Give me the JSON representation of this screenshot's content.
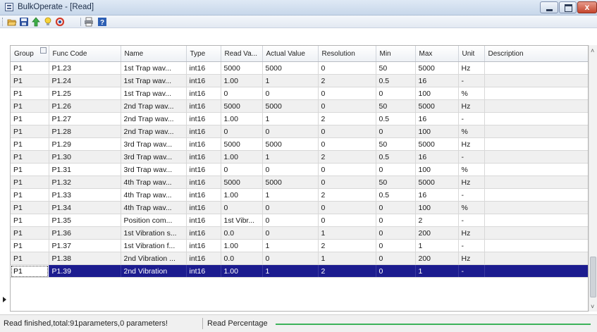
{
  "window": {
    "title": "BulkOperate - [Read]",
    "close_glyph": "x"
  },
  "toolbar": {
    "icons": [
      "open-folder-icon",
      "save-icon",
      "upload-arrow-icon",
      "lightbulb-icon",
      "refresh-icon",
      "print-icon",
      "help-icon"
    ]
  },
  "table": {
    "columns": [
      "Group",
      "Func Code",
      "Name",
      "Type",
      "Read Va...",
      "Actual Value",
      "Resolution",
      "Min",
      "Max",
      "Unit",
      "Description"
    ],
    "rows": [
      {
        "group": "P1",
        "code": "P1.23",
        "name": "1st Trap wav...",
        "type": "int16",
        "read": "5000",
        "actual": "5000",
        "resolution": "0",
        "min": "50",
        "max": "5000",
        "unit": "Hz",
        "desc": ""
      },
      {
        "group": "P1",
        "code": "P1.24",
        "name": "1st Trap wav...",
        "type": "int16",
        "read": "1.00",
        "actual": "1",
        "resolution": "2",
        "min": "0.5",
        "max": "16",
        "unit": "-",
        "desc": ""
      },
      {
        "group": "P1",
        "code": "P1.25",
        "name": "1st Trap wav...",
        "type": "int16",
        "read": "0",
        "actual": "0",
        "resolution": "0",
        "min": "0",
        "max": "100",
        "unit": "%",
        "desc": ""
      },
      {
        "group": "P1",
        "code": "P1.26",
        "name": "2nd Trap wav...",
        "type": "int16",
        "read": "5000",
        "actual": "5000",
        "resolution": "0",
        "min": "50",
        "max": "5000",
        "unit": "Hz",
        "desc": ""
      },
      {
        "group": "P1",
        "code": "P1.27",
        "name": "2nd Trap wav...",
        "type": "int16",
        "read": "1.00",
        "actual": "1",
        "resolution": "2",
        "min": "0.5",
        "max": "16",
        "unit": "-",
        "desc": ""
      },
      {
        "group": "P1",
        "code": "P1.28",
        "name": "2nd Trap wav...",
        "type": "int16",
        "read": "0",
        "actual": "0",
        "resolution": "0",
        "min": "0",
        "max": "100",
        "unit": "%",
        "desc": ""
      },
      {
        "group": "P1",
        "code": "P1.29",
        "name": "3rd Trap wav...",
        "type": "int16",
        "read": "5000",
        "actual": "5000",
        "resolution": "0",
        "min": "50",
        "max": "5000",
        "unit": "Hz",
        "desc": ""
      },
      {
        "group": "P1",
        "code": "P1.30",
        "name": "3rd Trap wav...",
        "type": "int16",
        "read": "1.00",
        "actual": "1",
        "resolution": "2",
        "min": "0.5",
        "max": "16",
        "unit": "-",
        "desc": ""
      },
      {
        "group": "P1",
        "code": "P1.31",
        "name": "3rd Trap wav...",
        "type": "int16",
        "read": "0",
        "actual": "0",
        "resolution": "0",
        "min": "0",
        "max": "100",
        "unit": "%",
        "desc": ""
      },
      {
        "group": "P1",
        "code": "P1.32",
        "name": "4th Trap wav...",
        "type": "int16",
        "read": "5000",
        "actual": "5000",
        "resolution": "0",
        "min": "50",
        "max": "5000",
        "unit": "Hz",
        "desc": ""
      },
      {
        "group": "P1",
        "code": "P1.33",
        "name": "4th Trap wav...",
        "type": "int16",
        "read": "1.00",
        "actual": "1",
        "resolution": "2",
        "min": "0.5",
        "max": "16",
        "unit": "-",
        "desc": ""
      },
      {
        "group": "P1",
        "code": "P1.34",
        "name": "4th Trap wav...",
        "type": "int16",
        "read": "0",
        "actual": "0",
        "resolution": "0",
        "min": "0",
        "max": "100",
        "unit": "%",
        "desc": ""
      },
      {
        "group": "P1",
        "code": "P1.35",
        "name": "Position com...",
        "type": "int16",
        "read": "1st Vibr...",
        "actual": "0",
        "resolution": "0",
        "min": "0",
        "max": "2",
        "unit": "-",
        "desc": ""
      },
      {
        "group": "P1",
        "code": "P1.36",
        "name": "1st Vibration s...",
        "type": "int16",
        "read": "0.0",
        "actual": "0",
        "resolution": "1",
        "min": "0",
        "max": "200",
        "unit": "Hz",
        "desc": ""
      },
      {
        "group": "P1",
        "code": "P1.37",
        "name": "1st Vibration f...",
        "type": "int16",
        "read": "1.00",
        "actual": "1",
        "resolution": "2",
        "min": "0",
        "max": "1",
        "unit": "-",
        "desc": ""
      },
      {
        "group": "P1",
        "code": "P1.38",
        "name": "2nd Vibration ...",
        "type": "int16",
        "read": "0.0",
        "actual": "0",
        "resolution": "1",
        "min": "0",
        "max": "200",
        "unit": "Hz",
        "desc": ""
      },
      {
        "group": "P1",
        "code": "P1.39",
        "name": "2nd Vibration",
        "type": "int16",
        "read": "1.00",
        "actual": "1",
        "resolution": "2",
        "min": "0",
        "max": "1",
        "unit": "-",
        "desc": ""
      }
    ],
    "selected_row": 16
  },
  "statusbar": {
    "message": "Read finished,total:91parameters,0 parameters!",
    "progress_label": "Read Percentage",
    "progress_value": 1.0,
    "progress_color": "#3cb35a"
  },
  "colors": {
    "selection": "#1c1c8f",
    "title_gradient_top": "#dfe9f5",
    "close_button": "#c4452c"
  }
}
